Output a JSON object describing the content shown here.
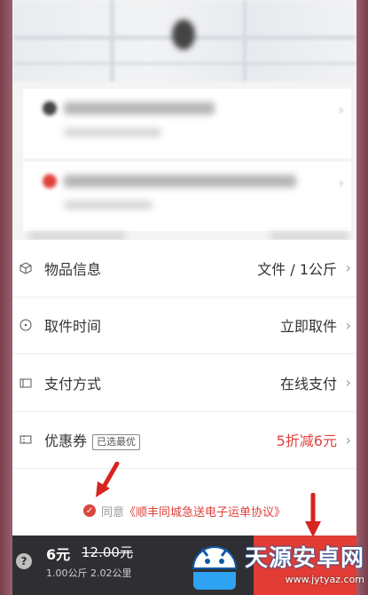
{
  "items": [
    {
      "icon": "package-icon",
      "label": "物品信息",
      "value": "文件 / 1公斤",
      "value_style": "normal"
    },
    {
      "icon": "clock-icon",
      "label": "取件时间",
      "value": "立即取件",
      "value_style": "normal"
    },
    {
      "icon": "card-icon",
      "label": "支付方式",
      "value": "在线支付",
      "value_style": "normal"
    },
    {
      "icon": "ticket-icon",
      "label": "优惠券",
      "badge": "已选最优",
      "value": "5折减6元",
      "value_style": "red"
    }
  ],
  "agreement": {
    "prefix": "同意",
    "link": "《顺丰同城急送电子运单协议》"
  },
  "bottom_bar": {
    "help_symbol": "?",
    "price": "6元",
    "original_price": "12.00元",
    "details": "1.00公斤 2.02公里"
  },
  "watermark": {
    "title": "天源安卓网",
    "url": "www.jytyaz.com"
  },
  "colors": {
    "accent_red": "#e23c35",
    "bottom_bar": "#2f2f33",
    "frame": "#8a4f5c"
  }
}
